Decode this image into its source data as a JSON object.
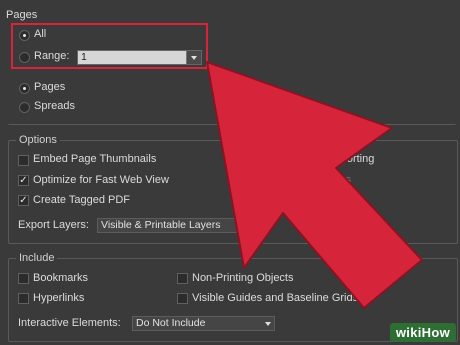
{
  "pages_section": {
    "title": "Pages",
    "all_label": "All",
    "range_label": "Range:",
    "range_value": "1",
    "pages_label": "Pages",
    "spreads_label": "Spreads"
  },
  "options_section": {
    "title": "Options",
    "embed_thumbnails": "Embed Page Thumbnails",
    "optimize_web": "Optimize for Fast Web View",
    "tagged_pdf": "Create Tagged PDF",
    "view_after_partial": "ter Exporting",
    "layers_partial": "t Layers",
    "export_layers_label": "Export Layers:",
    "export_layers_value": "Visible & Printable Layers"
  },
  "include_section": {
    "title": "Include",
    "bookmarks": "Bookmarks",
    "hyperlinks": "Hyperlinks",
    "non_printing": "Non-Printing Objects",
    "visible_guides": "Visible Guides and Baseline Grids",
    "interactive_label": "Interactive Elements:",
    "interactive_value": "Do Not Include"
  },
  "colors": {
    "arrow": "#d6243a",
    "highlight": "#d6243a"
  },
  "watermark": "wikiHow"
}
